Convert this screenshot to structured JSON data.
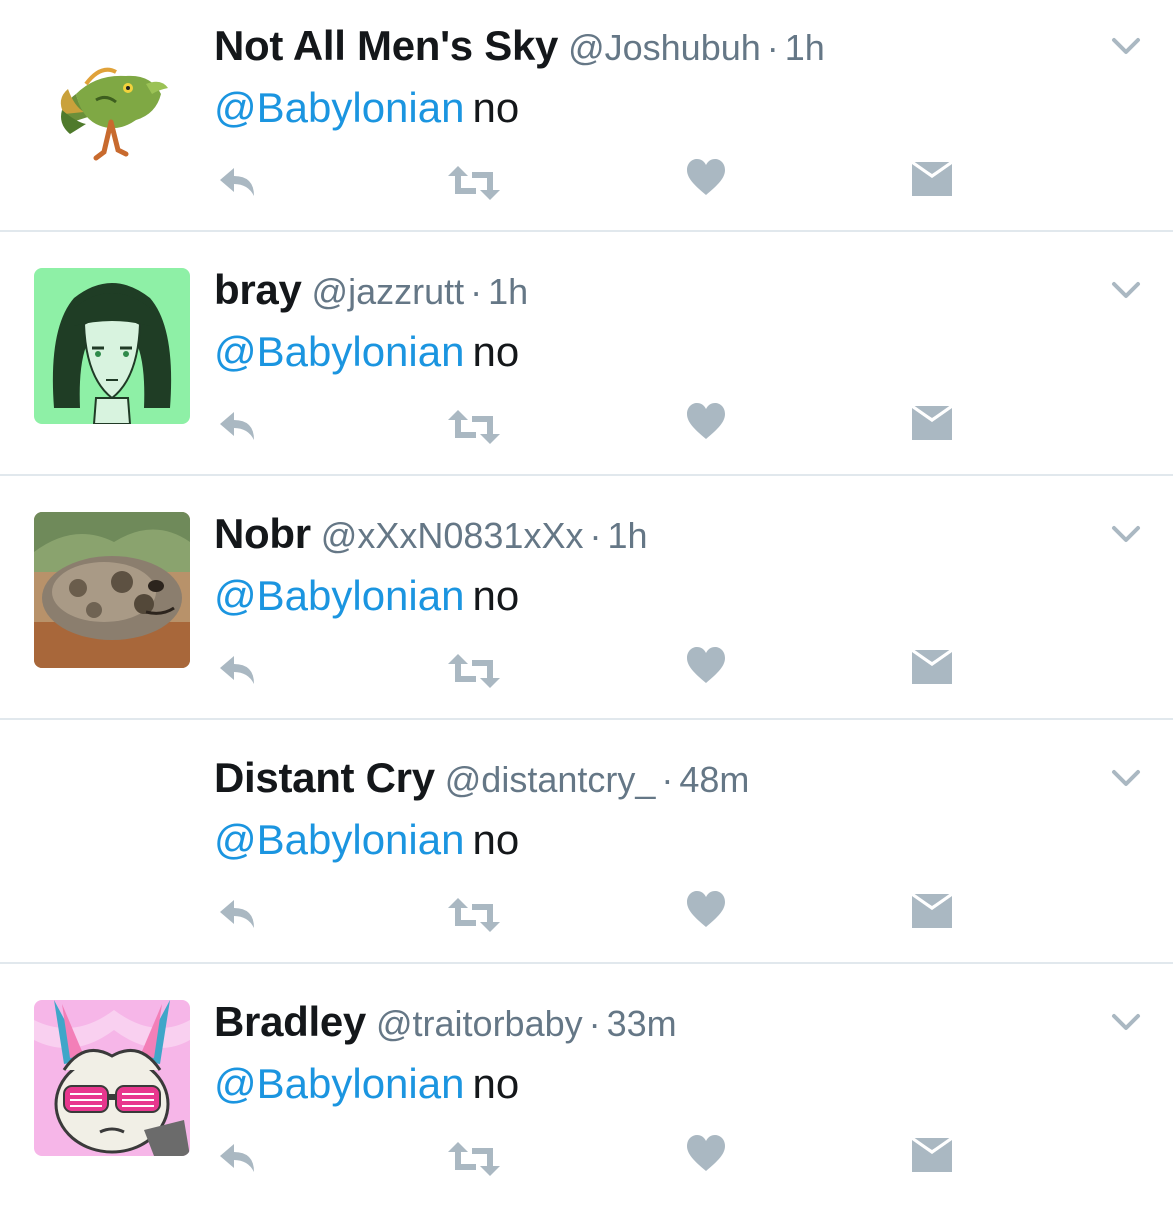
{
  "colors": {
    "name": "#14171a",
    "meta": "#657786",
    "mention": "#1b95e0",
    "icon": "#aab8c2",
    "divider": "#e1e8ed"
  },
  "icons": {
    "reply": "reply-icon",
    "retweet": "retweet-icon",
    "like": "heart-icon",
    "message": "envelope-icon",
    "menu": "chevron-down-icon"
  },
  "tweets": [
    {
      "name": "Not All Men's Sky",
      "handle": "@Joshubuh",
      "separator": "·",
      "time": "1h",
      "mention": "@Babylonian",
      "text": "no",
      "avatar": "green-creature-avatar"
    },
    {
      "name": "bray",
      "handle": "@jazzrutt",
      "separator": "·",
      "time": "1h",
      "mention": "@Babylonian",
      "text": "no",
      "avatar": "anime-girl-avatar"
    },
    {
      "name": "Nobr",
      "handle": "@xXxN0831xXx",
      "separator": "·",
      "time": "1h",
      "mention": "@Babylonian",
      "text": "no",
      "avatar": "frog-avatar"
    },
    {
      "name": "Distant Cry",
      "handle": "@distantcry_",
      "separator": "·",
      "time": "48m",
      "mention": "@Babylonian",
      "text": "no",
      "avatar": "blank-avatar"
    },
    {
      "name": "Bradley",
      "handle": "@traitorbaby",
      "separator": "·",
      "time": "33m",
      "mention": "@Babylonian",
      "text": "no",
      "avatar": "eevee-sunglasses-avatar"
    }
  ]
}
